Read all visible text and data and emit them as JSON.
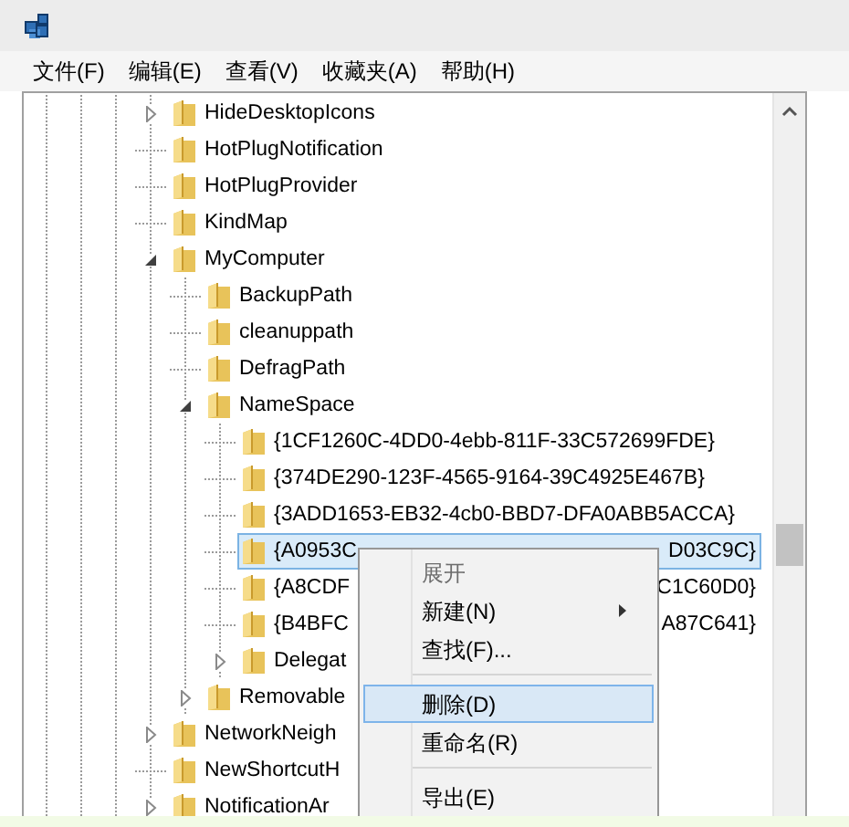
{
  "menu_bar": [
    {
      "label": "文件(F)"
    },
    {
      "label": "编辑(E)"
    },
    {
      "label": "查看(V)"
    },
    {
      "label": "收藏夹(A)"
    },
    {
      "label": "帮助(H)"
    }
  ],
  "tree": [
    {
      "label": "HideDesktopIcons",
      "has_children": true,
      "expanded": false,
      "selected": false
    },
    {
      "label": "HotPlugNotification",
      "has_children": false,
      "selected": false
    },
    {
      "label": "HotPlugProvider",
      "has_children": false,
      "selected": false
    },
    {
      "label": "KindMap",
      "has_children": false,
      "selected": false
    },
    {
      "label": "MyComputer",
      "has_children": true,
      "expanded": true,
      "selected": false,
      "children": [
        {
          "label": "BackupPath",
          "has_children": false,
          "selected": false
        },
        {
          "label": "cleanuppath",
          "has_children": false,
          "selected": false
        },
        {
          "label": "DefragPath",
          "has_children": false,
          "selected": false
        },
        {
          "label": "NameSpace",
          "has_children": true,
          "expanded": true,
          "selected": false,
          "children": [
            {
              "label": "{1CF1260C-4DD0-4ebb-811F-33C572699FDE}",
              "has_children": false,
              "selected": false
            },
            {
              "label": "{374DE290-123F-4565-9164-39C4925E467B}",
              "has_children": false,
              "selected": false
            },
            {
              "label": "{3ADD1653-EB32-4cb0-BBD7-DFA0ABB5ACCA}",
              "has_children": false,
              "selected": false
            },
            {
              "label": "{A0953C",
              "tail": "D03C9C}",
              "has_children": false,
              "selected": true
            },
            {
              "label": "{A8CDF",
              "tail": "C1C60D0}",
              "has_children": false,
              "selected": false
            },
            {
              "label": "{B4BFC",
              "tail": "A87C641}",
              "has_children": false,
              "selected": false
            },
            {
              "label": "Delegat",
              "has_children": true,
              "expanded": false,
              "selected": false
            }
          ]
        },
        {
          "label": "Removable",
          "has_children": true,
          "expanded": false,
          "selected": false
        }
      ]
    },
    {
      "label": "NetworkNeigh",
      "has_children": true,
      "expanded": false,
      "selected": false
    },
    {
      "label": "NewShortcutH",
      "has_children": false,
      "selected": false
    },
    {
      "label": "NotificationAr",
      "has_children": true,
      "expanded": false,
      "selected": false
    }
  ],
  "context_menu": [
    {
      "label": "展开",
      "disabled": true,
      "submenu": false,
      "selected": false,
      "separator_after": false
    },
    {
      "label": "新建(N)",
      "disabled": false,
      "submenu": true,
      "selected": false,
      "separator_after": false
    },
    {
      "label": "查找(F)...",
      "disabled": false,
      "submenu": false,
      "selected": false,
      "separator_after": true
    },
    {
      "label": "删除(D)",
      "disabled": false,
      "submenu": false,
      "selected": true,
      "separator_after": false
    },
    {
      "label": "重命名(R)",
      "disabled": false,
      "submenu": false,
      "selected": false,
      "separator_after": true
    },
    {
      "label": "导出(E)",
      "disabled": false,
      "submenu": false,
      "selected": false
    }
  ]
}
